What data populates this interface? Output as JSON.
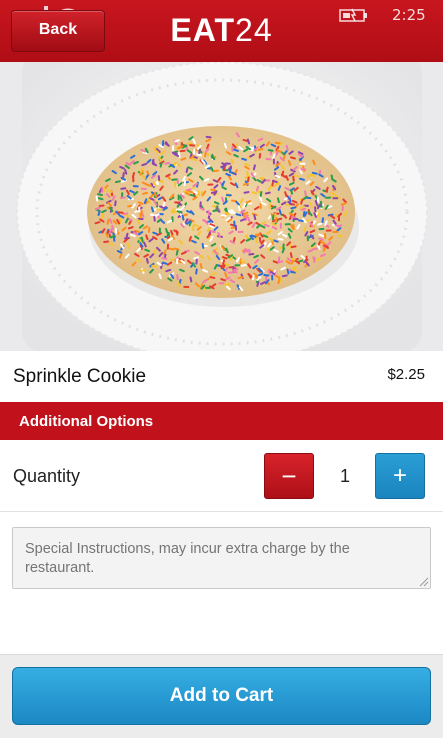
{
  "status_bar": {
    "time": "2:25",
    "icons": [
      "signal-icon",
      "wifi-icon",
      "battery-icon"
    ]
  },
  "header": {
    "back_label": "Back",
    "logo_text_letters": "EAT",
    "logo_text_number": "24",
    "brand_color": "#c1121b"
  },
  "product": {
    "image": "sprinkle-cookie-photo",
    "name": "Sprinkle Cookie",
    "price": "$2.25"
  },
  "options": {
    "section_title": "Additional Options",
    "quantity_label": "Quantity",
    "quantity_value": "1",
    "minus_symbol": "−",
    "plus_symbol": "+"
  },
  "instructions": {
    "placeholder": "Special Instructions, may incur extra charge by the restaurant."
  },
  "footer": {
    "add_to_cart_label": "Add to Cart",
    "button_color": "#1c88c4"
  }
}
